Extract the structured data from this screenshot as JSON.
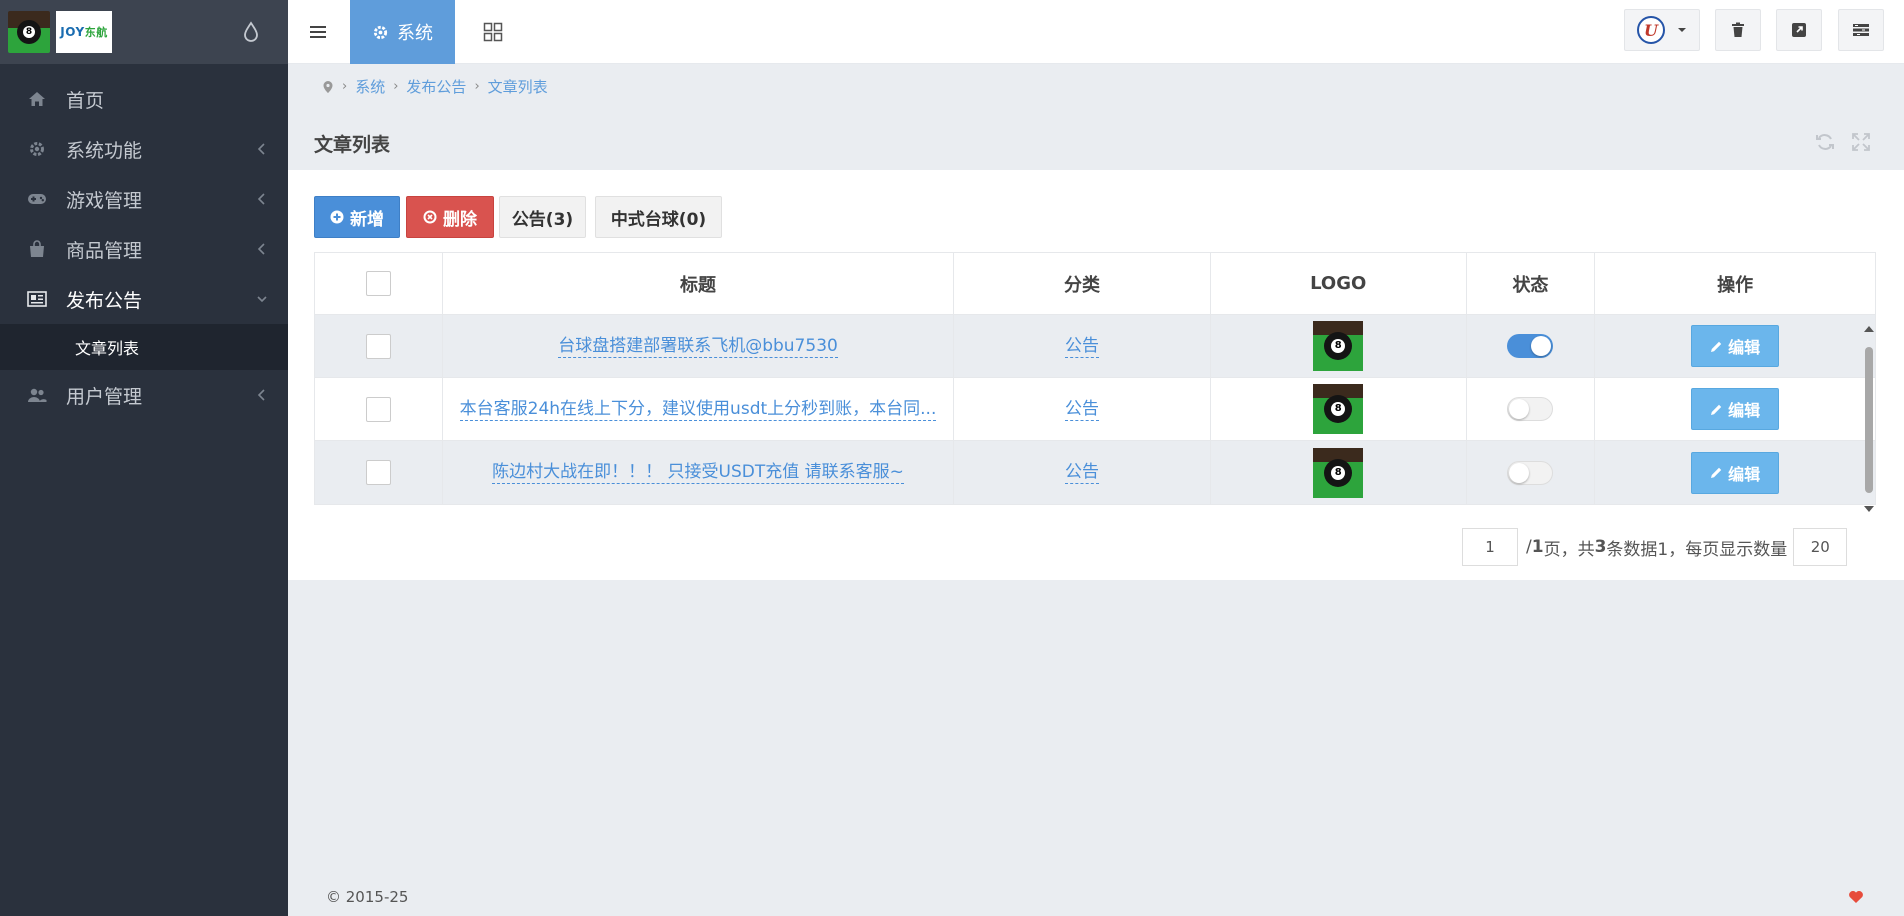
{
  "sidebar": {
    "logo_text": "JOY",
    "logo_text_sub": "东航",
    "ball_number": "8",
    "menu": [
      {
        "label": "首页",
        "icon": "home-icon",
        "has_chevron": false
      },
      {
        "label": "系统功能",
        "icon": "gear-icon",
        "has_chevron": true
      },
      {
        "label": "游戏管理",
        "icon": "gamepad-icon",
        "has_chevron": true
      },
      {
        "label": "商品管理",
        "icon": "shopping-bag-icon",
        "has_chevron": true
      },
      {
        "label": "发布公告",
        "icon": "newspaper-icon",
        "has_chevron": true,
        "active": true
      },
      {
        "label": "用户管理",
        "icon": "users-icon",
        "has_chevron": true
      }
    ],
    "submenu_active": "文章列表"
  },
  "topbar": {
    "tab_label": "系统",
    "avatar_letter": "U"
  },
  "breadcrumb": [
    "系统",
    "发布公告",
    "文章列表"
  ],
  "panel": {
    "title": "文章列表",
    "buttons": {
      "add": "新增",
      "delete": "删除",
      "tab_notice": "公告(3)",
      "tab_billiards": "中式台球(0)"
    }
  },
  "table": {
    "columns": [
      "标题",
      "分类",
      "LOGO",
      "状态",
      "操作"
    ],
    "rows": [
      {
        "title": "台球盘搭建部署联系飞机@bbu7530",
        "category": "公告",
        "status": true,
        "action": "编辑"
      },
      {
        "title": "本台客服24h在线上下分，建议使用usdt上分秒到账，本台同...",
        "category": "公告",
        "status": false,
        "action": "编辑"
      },
      {
        "title": "陈边村大战在即！！！ 只接受USDT充值 请联系客服~",
        "category": "公告",
        "status": false,
        "action": "编辑"
      }
    ]
  },
  "pagination": {
    "current_page": "1",
    "text_pages": "/ ",
    "total_pages": "1",
    "text_page_unit": " 页，共 ",
    "total_records": "3",
    "text_records": " 条数据1，每页显示数量",
    "page_size": "20"
  },
  "footer": {
    "copyright": "© 2015-25"
  },
  "colors": {
    "sidebar_bg": "#2a313d",
    "accent": "#5f9ddb",
    "danger": "#d9534f",
    "edit_button": "#6bb6ec",
    "heart": "#e74c3c"
  }
}
